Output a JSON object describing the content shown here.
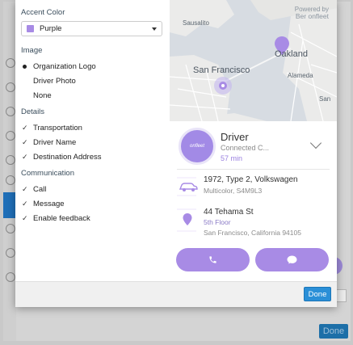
{
  "background": {
    "done_label": "Done"
  },
  "settings": {
    "accent": {
      "heading": "Accent Color",
      "selected": "Purple",
      "color": "#a88be5"
    },
    "image": {
      "heading": "Image",
      "options": [
        "Organization Logo",
        "Driver Photo",
        "None"
      ],
      "selected": "Organization Logo"
    },
    "details": {
      "heading": "Details",
      "items": [
        "Transportation",
        "Driver Name",
        "Destination Address"
      ]
    },
    "communication": {
      "heading": "Communication",
      "items": [
        "Call",
        "Message",
        "Enable feedback"
      ]
    }
  },
  "preview": {
    "powered_by": "Powered by",
    "brand": "Ber onfleet",
    "map_labels": {
      "sausalito": "Sausalito",
      "oakland": "Oakland",
      "san_francisco": "San Francisco",
      "alameda": "Alameda",
      "san": "San"
    },
    "logo_text": "onfleet",
    "driver": {
      "name": "Driver",
      "status": "Connected C...",
      "eta": "57 min"
    },
    "vehicle": {
      "description": "1972, Type 2, Volkswagen",
      "details": "Multicolor, S4M9L3"
    },
    "destination": {
      "street": "44 Tehama St",
      "unit": "5th Floor",
      "city": "San Francisco, California 94105"
    }
  },
  "footer": {
    "done_label": "Done"
  },
  "colors": {
    "accent": "#a88be5",
    "primary_button": "#2a8fd7"
  }
}
